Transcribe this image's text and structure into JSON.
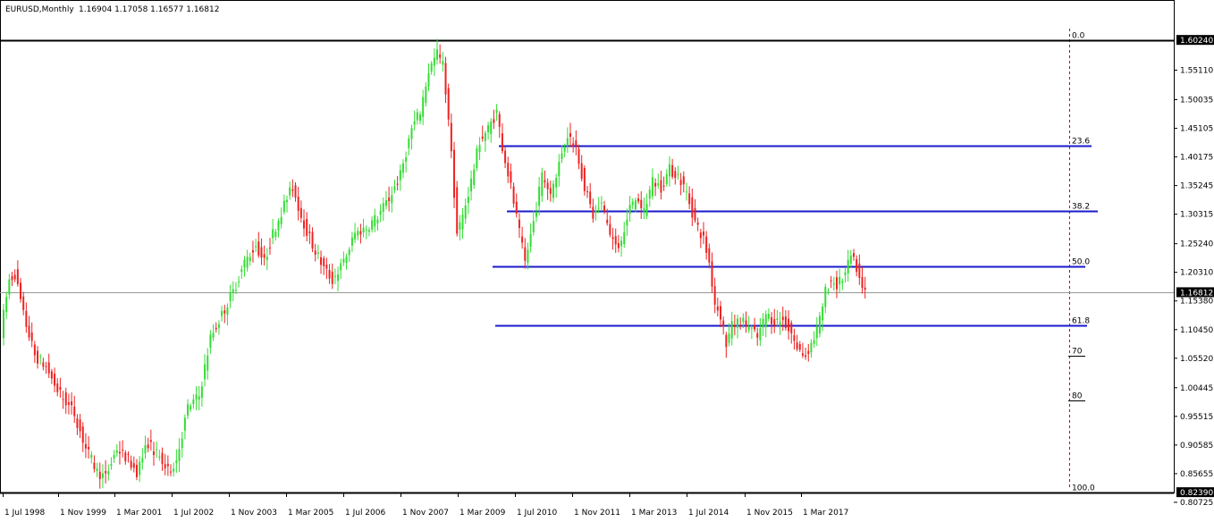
{
  "header": {
    "symbol": "EURUSD,Monthly",
    "ohlc": "1.16904 1.17058 1.16577 1.16812"
  },
  "chart_data": {
    "type": "candlestick",
    "symbol": "EURUSD",
    "timeframe": "Monthly",
    "ylim": [
      0.8272,
      1.6242
    ],
    "colors": {
      "bullish": "#33dd33",
      "bearish": "#ee2222",
      "fib_level": "#1a1acc",
      "fib_extreme": "#000000",
      "fib_vertical": "#cc0000",
      "current_price_line": "#999999"
    },
    "price_axis_labels": [
      "1.55110",
      "1.50035",
      "1.45105",
      "1.40175",
      "1.35245",
      "1.30315",
      "1.25240",
      "1.20310",
      "1.15380",
      "1.10450",
      "1.05520",
      "1.00445",
      "0.95515",
      "0.90585",
      "0.85655",
      "0.80725"
    ],
    "price_tags": [
      {
        "label": "1.60240",
        "value": 1.6024
      },
      {
        "label": "1.16812",
        "value": 1.16812
      },
      {
        "label": "0.82390",
        "value": 0.8239
      }
    ],
    "x_axis_labels": [
      "1 Jul 1998",
      "1 Nov 1999",
      "1 Mar 2001",
      "1 Jul 2002",
      "1 Nov 2003",
      "1 Mar 2005",
      "1 Jul 2006",
      "1 Nov 2007",
      "1 Mar 2009",
      "1 Jul 2010",
      "1 Nov 2011",
      "1 Mar 2013",
      "1 Jul 2014",
      "1 Nov 2015",
      "1 Mar 2017"
    ],
    "fibonacci": [
      {
        "label": "0.0",
        "price": 1.6024
      },
      {
        "label": "23.6",
        "price": 1.4211
      },
      {
        "label": "38.2",
        "price": 1.3088
      },
      {
        "label": "50.0",
        "price": 1.2132
      },
      {
        "label": "61.8",
        "price": 1.1125
      },
      {
        "label": "70",
        "price": 1.0595
      },
      {
        "label": "80",
        "price": 0.9825
      },
      {
        "label": "100.0",
        "price": 0.8239
      }
    ],
    "current_price": 1.16812,
    "price_path": [
      [
        0,
        1.1
      ],
      [
        3,
        1.19
      ],
      [
        5,
        1.2
      ],
      [
        8,
        1.13
      ],
      [
        12,
        1.06
      ],
      [
        16,
        1.04
      ],
      [
        20,
        1.0
      ],
      [
        26,
        0.96
      ],
      [
        30,
        0.9
      ],
      [
        34,
        0.86
      ],
      [
        37,
        0.85
      ],
      [
        41,
        0.9
      ],
      [
        45,
        0.88
      ],
      [
        48,
        0.86
      ],
      [
        52,
        0.91
      ],
      [
        55,
        0.89
      ],
      [
        59,
        0.86
      ],
      [
        62,
        0.88
      ],
      [
        66,
        0.97
      ],
      [
        70,
        0.99
      ],
      [
        74,
        1.09
      ],
      [
        78,
        1.13
      ],
      [
        82,
        1.17
      ],
      [
        86,
        1.22
      ],
      [
        90,
        1.25
      ],
      [
        93,
        1.22
      ],
      [
        96,
        1.27
      ],
      [
        100,
        1.32
      ],
      [
        103,
        1.35
      ],
      [
        106,
        1.3
      ],
      [
        110,
        1.25
      ],
      [
        114,
        1.21
      ],
      [
        117,
        1.19
      ],
      [
        121,
        1.22
      ],
      [
        125,
        1.27
      ],
      [
        129,
        1.28
      ],
      [
        133,
        1.3
      ],
      [
        137,
        1.33
      ],
      [
        141,
        1.37
      ],
      [
        145,
        1.45
      ],
      [
        148,
        1.48
      ],
      [
        151,
        1.55
      ],
      [
        154,
        1.58
      ],
      [
        156,
        1.56
      ],
      [
        158,
        1.47
      ],
      [
        160,
        1.34
      ],
      [
        161,
        1.27
      ],
      [
        163,
        1.3
      ],
      [
        166,
        1.36
      ],
      [
        169,
        1.43
      ],
      [
        172,
        1.45
      ],
      [
        175,
        1.48
      ],
      [
        177,
        1.42
      ],
      [
        180,
        1.35
      ],
      [
        183,
        1.27
      ],
      [
        185,
        1.22
      ],
      [
        188,
        1.29
      ],
      [
        191,
        1.37
      ],
      [
        194,
        1.34
      ],
      [
        197,
        1.39
      ],
      [
        200,
        1.44
      ],
      [
        203,
        1.42
      ],
      [
        206,
        1.35
      ],
      [
        209,
        1.3
      ],
      [
        212,
        1.32
      ],
      [
        215,
        1.27
      ],
      [
        218,
        1.24
      ],
      [
        221,
        1.3
      ],
      [
        224,
        1.33
      ],
      [
        227,
        1.31
      ],
      [
        230,
        1.36
      ],
      [
        233,
        1.35
      ],
      [
        236,
        1.38
      ],
      [
        239,
        1.37
      ],
      [
        242,
        1.34
      ],
      [
        245,
        1.29
      ],
      [
        248,
        1.26
      ],
      [
        250,
        1.22
      ],
      [
        252,
        1.15
      ],
      [
        254,
        1.13
      ],
      [
        256,
        1.08
      ],
      [
        258,
        1.11
      ],
      [
        261,
        1.12
      ],
      [
        264,
        1.11
      ],
      [
        267,
        1.09
      ],
      [
        270,
        1.13
      ],
      [
        273,
        1.12
      ],
      [
        276,
        1.12
      ],
      [
        279,
        1.1
      ],
      [
        281,
        1.07
      ],
      [
        284,
        1.06
      ],
      [
        287,
        1.09
      ],
      [
        289,
        1.12
      ],
      [
        291,
        1.17
      ],
      [
        293,
        1.19
      ],
      [
        295,
        1.18
      ],
      [
        298,
        1.2
      ],
      [
        300,
        1.23
      ],
      [
        302,
        1.21
      ],
      [
        304,
        1.17
      ]
    ]
  }
}
